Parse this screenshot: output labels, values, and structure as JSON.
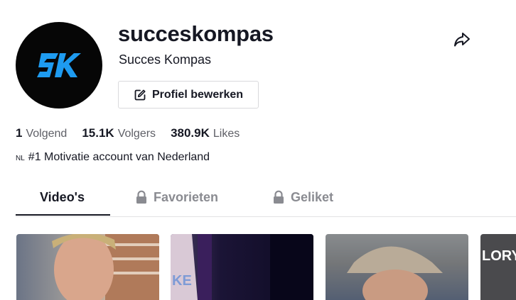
{
  "profile": {
    "username": "succeskompas",
    "nickname": "Succes Kompas",
    "avatar_logo": "SK",
    "edit_button_label": "Profiel bewerken"
  },
  "stats": [
    {
      "value": "1",
      "label": "Volgend"
    },
    {
      "value": "15.1K",
      "label": "Volgers"
    },
    {
      "value": "380.9K",
      "label": "Likes"
    }
  ],
  "bio": {
    "flag": "NL",
    "text": "#1 Motivatie account van Nederland"
  },
  "tabs": [
    {
      "label": "Video's",
      "locked": false,
      "active": true
    },
    {
      "label": "Favorieten",
      "locked": true,
      "active": false
    },
    {
      "label": "Geliket",
      "locked": true,
      "active": false
    }
  ],
  "thumbnails": [
    {
      "overlay_text": ""
    },
    {
      "overlay_text": ""
    },
    {
      "overlay_text": ""
    },
    {
      "overlay_text": "LORY"
    }
  ],
  "colors": {
    "brand_blue": "#1e9bf0",
    "text_primary": "#161823",
    "text_secondary": "#8a8b91"
  }
}
